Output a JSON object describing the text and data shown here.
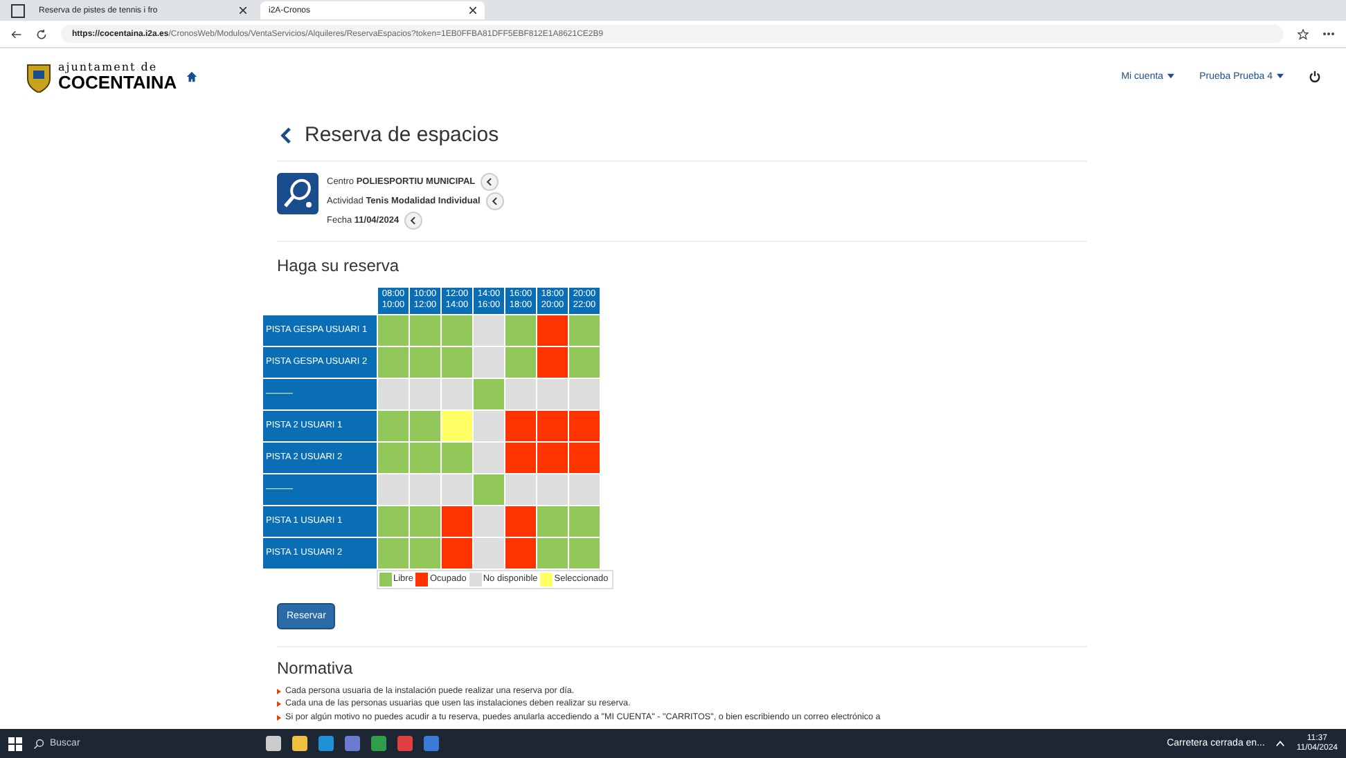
{
  "browser": {
    "tabs": [
      {
        "title": "Reserva de pistes de tennis i fro",
        "selected": false
      },
      {
        "title": "i2A-Cronos",
        "selected": true
      }
    ],
    "url_host": "https://cocentaina.i2a.es",
    "url_path": "/CronosWeb/Modulos/VentaServicios/Alquileres/ReservaEspacios?token=1EB0FFBA81DFF5EBF812E1A8621CE2B9"
  },
  "header": {
    "logo_top": "ajuntament de",
    "logo_bottom": "COCENTAINA",
    "menus": [
      "Mi cuenta",
      "Prueba Prueba 4"
    ]
  },
  "page_title": "Reserva de espacios",
  "filters": [
    {
      "label": "Centro",
      "value": "POLIESPORTIU MUNICIPAL"
    },
    {
      "label": "Actividad",
      "value": "Tenis Modalidad Individual"
    },
    {
      "label": "Fecha",
      "value": "11/04/2024"
    }
  ],
  "section_title": "Haga su reserva",
  "grid": {
    "columns": [
      {
        "from": "08:00",
        "to": "10:00"
      },
      {
        "from": "10:00",
        "to": "12:00"
      },
      {
        "from": "12:00",
        "to": "14:00"
      },
      {
        "from": "14:00",
        "to": "16:00"
      },
      {
        "from": "16:00",
        "to": "18:00"
      },
      {
        "from": "18:00",
        "to": "20:00"
      },
      {
        "from": "20:00",
        "to": "22:00"
      }
    ],
    "rows": [
      {
        "label": "PISTA GESPA USUARI 1",
        "cells": [
          {
            "kind": "libre"
          },
          {
            "kind": "libre"
          },
          {
            "kind": "libre"
          },
          {
            "kind": "no"
          },
          {
            "kind": "libre"
          },
          {
            "kind": "ocupado"
          },
          {
            "kind": "libre"
          }
        ]
      },
      {
        "label": "PISTA GESPA USUARI 2",
        "cells": [
          {
            "kind": "libre"
          },
          {
            "kind": "libre"
          },
          {
            "kind": "libre"
          },
          {
            "kind": "no"
          },
          {
            "kind": "libre"
          },
          {
            "kind": "ocupado"
          },
          {
            "kind": "libre"
          }
        ]
      },
      {
        "label": "———",
        "cells": [
          {
            "kind": "no"
          },
          {
            "kind": "no"
          },
          {
            "kind": "no"
          },
          {
            "kind": "libre"
          },
          {
            "kind": "no"
          },
          {
            "kind": "no"
          },
          {
            "kind": "no"
          }
        ]
      },
      {
        "label": "PISTA 2 USUARI 1",
        "cells": [
          {
            "kind": "libre"
          },
          {
            "kind": "libre"
          },
          {
            "kind": "sel"
          },
          {
            "kind": "no"
          },
          {
            "kind": "ocupado"
          },
          {
            "kind": "ocupado"
          },
          {
            "kind": "ocupado"
          }
        ]
      },
      {
        "label": "PISTA 2 USUARI 2",
        "cells": [
          {
            "kind": "libre"
          },
          {
            "kind": "libre"
          },
          {
            "kind": "libre"
          },
          {
            "kind": "no"
          },
          {
            "kind": "ocupado"
          },
          {
            "kind": "ocupado"
          },
          {
            "kind": "ocupado"
          }
        ]
      },
      {
        "label": "———",
        "cells": [
          {
            "kind": "no"
          },
          {
            "kind": "no"
          },
          {
            "kind": "no"
          },
          {
            "kind": "libre"
          },
          {
            "kind": "no"
          },
          {
            "kind": "no"
          },
          {
            "kind": "no"
          }
        ]
      },
      {
        "label": "PISTA 1 USUARI 1",
        "cells": [
          {
            "kind": "libre"
          },
          {
            "kind": "libre"
          },
          {
            "kind": "ocupado"
          },
          {
            "kind": "no"
          },
          {
            "kind": "ocupado"
          },
          {
            "kind": "libre"
          },
          {
            "kind": "libre"
          }
        ]
      },
      {
        "label": "PISTA 1 USUARI 2",
        "cells": [
          {
            "kind": "libre"
          },
          {
            "kind": "libre"
          },
          {
            "kind": "ocupado"
          },
          {
            "kind": "no"
          },
          {
            "kind": "ocupado"
          },
          {
            "kind": "libre"
          },
          {
            "kind": "libre"
          }
        ]
      }
    ],
    "legend": [
      {
        "kind": "libre",
        "label": "Libre",
        "color": "#92c85a"
      },
      {
        "kind": "ocupado",
        "label": "Ocupado",
        "color": "#ff3300"
      },
      {
        "kind": "no",
        "label": "No disponible",
        "color": "#dddddd"
      },
      {
        "kind": "sel",
        "label": "Seleccionado",
        "color": "#ffff66"
      }
    ]
  },
  "reserve_button": "Reservar",
  "rules_title": "Normativa",
  "rules": [
    "Cada persona usuaria de la instalación puede realizar una reserva por día.",
    "Cada una de las personas usuarias que usen las instalaciones deben realizar su reserva.",
    "Si por algún motivo no puedes acudir a tu reserva, puedes anularla accediendo a \"MI CUENTA\" - \"CARRITOS\", o bien escribiendo un correo electrónico a"
  ],
  "taskbar": {
    "search": "Buscar",
    "notice": "Carretera cerrada en...",
    "time": "11:37",
    "date": "11/04/2024"
  }
}
